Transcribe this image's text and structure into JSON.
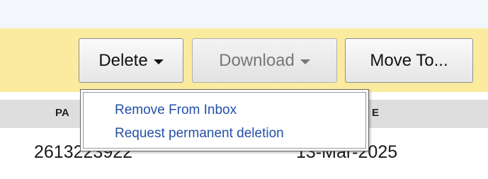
{
  "toolbar": {
    "delete_label": "Delete",
    "download_label": "Download",
    "move_label": "Move To..."
  },
  "delete_menu": {
    "items": [
      "Remove From Inbox",
      "Request permanent deletion"
    ]
  },
  "table": {
    "columns": [
      "PA",
      "E"
    ],
    "rows": [
      {
        "number": "2613223922",
        "date": "13-Mar-2025"
      }
    ]
  },
  "colors": {
    "toolbar_bg": "#fbeb9f",
    "link": "#2550a8",
    "header_bg": "#dedede"
  }
}
